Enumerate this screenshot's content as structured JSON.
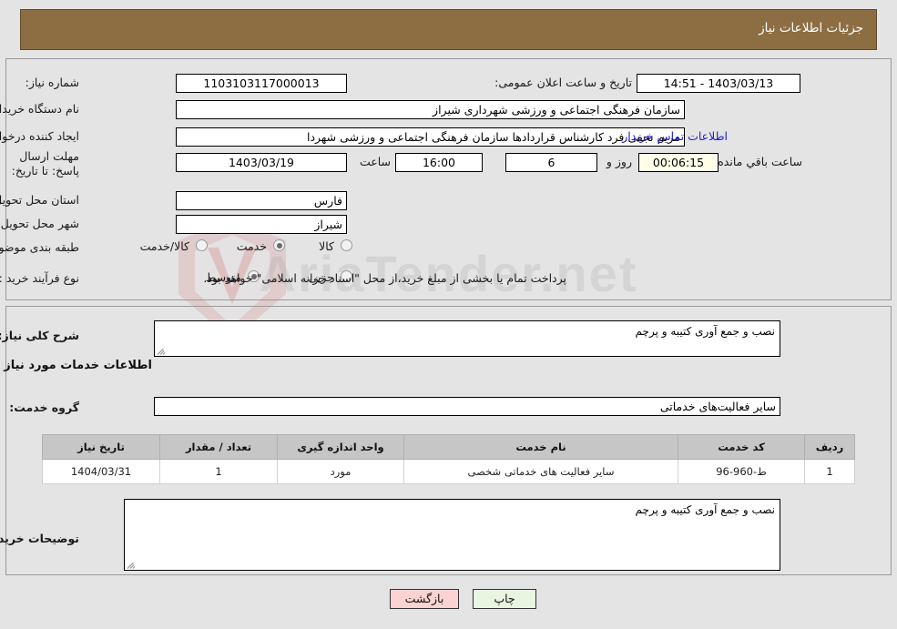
{
  "header": {
    "title": "جزئیات اطلاعات نیاز"
  },
  "watermark": {
    "text": "AriaTender.net"
  },
  "form": {
    "need_number_label": "شماره نیاز:",
    "need_number_value": "1103103117000013",
    "announce_label": "تاریخ و ساعت اعلان عمومی:",
    "announce_value": "14:51 - 1403/03/13",
    "buyer_org_label": "نام دستگاه خریدار:",
    "buyer_org_value": "سازمان فرهنگی اجتماعی و ورزشی شهرداری شیراز",
    "creator_label": "ایجاد کننده درخواست:",
    "creator_value": "مریم نجفی فرد کارشناس قراردادها سازمان فرهنگی اجتماعی و ورزشی شهردا",
    "contact_link": "اطلاعات تماس خریدار",
    "deadline_label": "مهلت ارسال پاسخ: تا تاریخ:",
    "deadline_date": "1403/03/19",
    "deadline_hour_label": "ساعت",
    "deadline_hour_value": "16:00",
    "remaining_days_value": "6",
    "remaining_days_label": "روز و",
    "remaining_time_value": "00:06:15",
    "remaining_time_label": "ساعت باقي مانده",
    "province_label": "استان محل تحویل:",
    "province_value": "فارس",
    "city_label": "شهر محل تحویل:",
    "city_value": "شیراز",
    "category_label": "طبقه بندی موضوعی:",
    "category_options": [
      "کالا",
      "خدمت",
      "کالا/خدمت"
    ],
    "category_selected": "خدمت",
    "process_label": "نوع فرآیند خرید :",
    "process_options": [
      "جزیی",
      "متوسط"
    ],
    "process_selected": "متوسط",
    "payment_note": "پرداخت تمام یا بخشی از مبلغ خرید،از محل \"اسناد خزانه اسلامی\" خواهد بود."
  },
  "summary": {
    "label": "شرح کلی نیاز:",
    "value": "نصب  و جمع آوری کتیبه و پرچم"
  },
  "services_section": {
    "heading": "اطلاعات خدمات مورد نیاز",
    "group_label": "گروه خدمت:",
    "group_value": "سایر فعالیت‌های خدماتی"
  },
  "table": {
    "columns": [
      "ردیف",
      "کد خدمت",
      "نام خدمت",
      "واحد اندازه گیری",
      "تعداد / مقدار",
      "تاریخ نیاز"
    ],
    "rows": [
      {
        "row": "1",
        "code": "ط-960-96",
        "name": "سایر فعالیت های خدماتی شخصی",
        "unit": "مورد",
        "qty": "1",
        "date": "1404/03/31"
      }
    ]
  },
  "buyer_notes": {
    "label": "توضیحات خریدار:",
    "value": "نصب  و جمع آوری کتیبه و پرچم"
  },
  "buttons": {
    "print": "چاپ",
    "back": "بازگشت"
  }
}
